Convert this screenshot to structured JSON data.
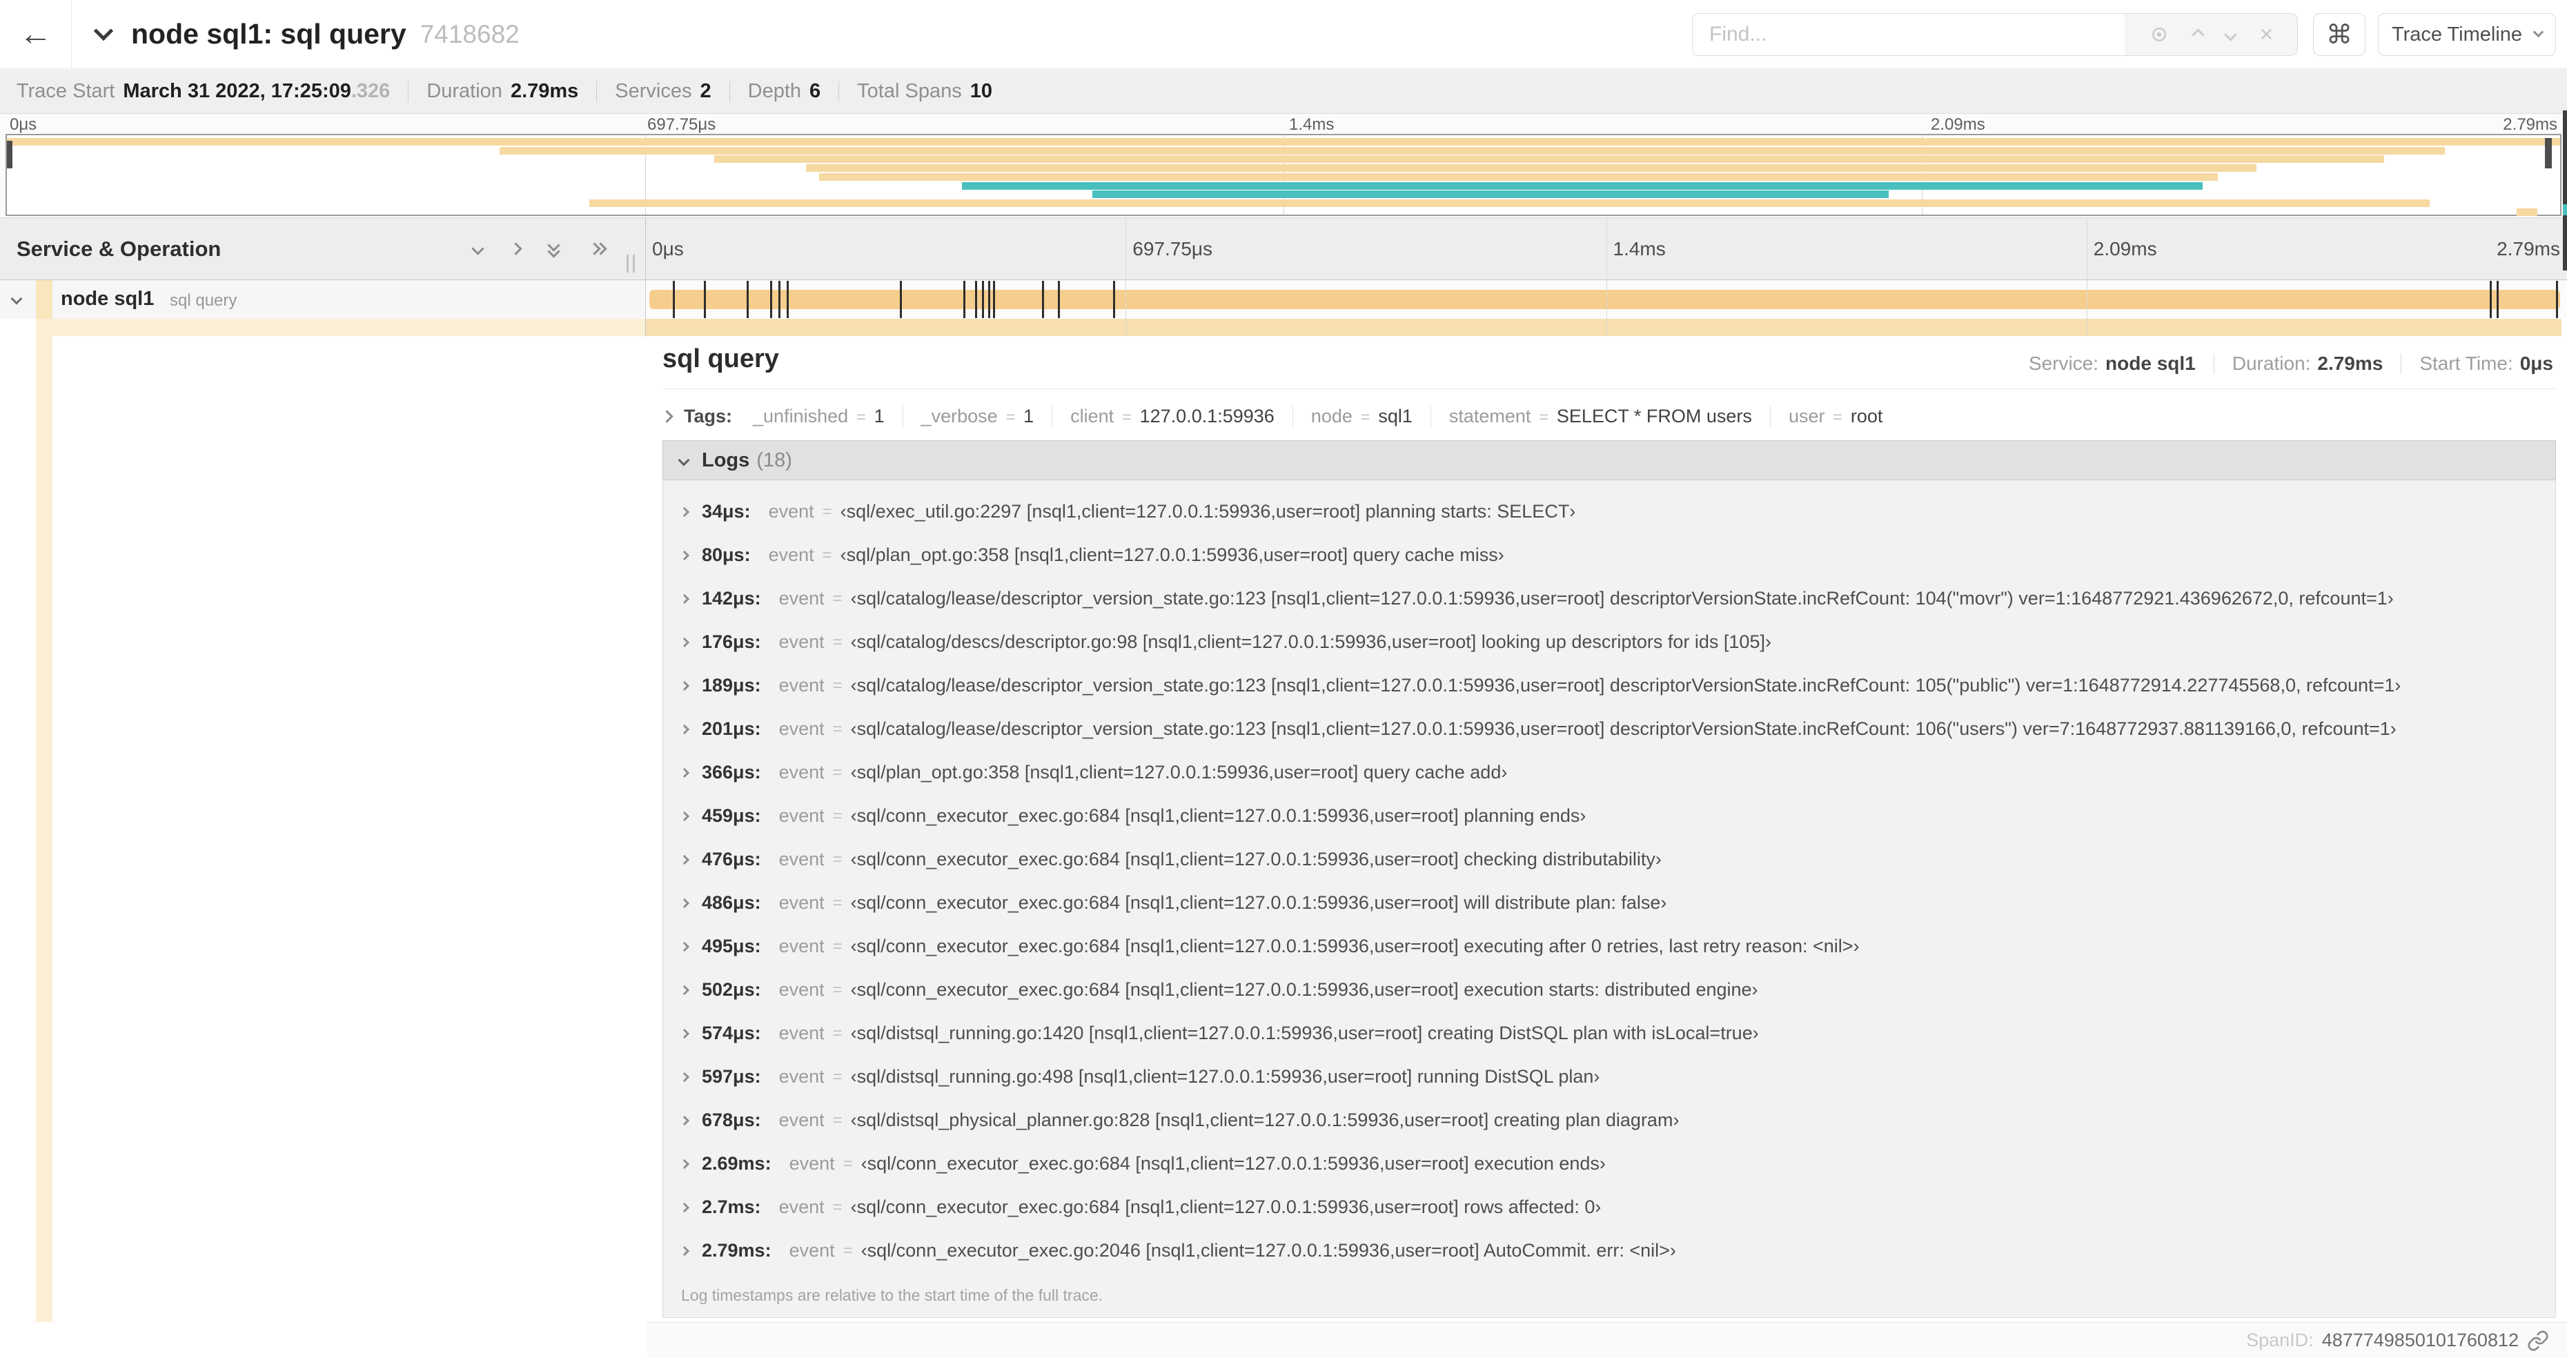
{
  "header": {
    "back_icon": "←",
    "title": "node sql1: sql query",
    "trace_id": "7418682",
    "find_placeholder": "Find...",
    "clear_icon": "×",
    "shortcut_icon": "⌘",
    "view_selector": "Trace Timeline"
  },
  "trace_stats": {
    "items": [
      {
        "label": "Trace Start",
        "value": "March 31 2022, 17:25:09",
        "extra": ".326"
      },
      {
        "label": "Duration",
        "value": "2.79ms",
        "extra": ""
      },
      {
        "label": "Services",
        "value": "2",
        "extra": ""
      },
      {
        "label": "Depth",
        "value": "6",
        "extra": ""
      },
      {
        "label": "Total Spans",
        "value": "10",
        "extra": ""
      }
    ]
  },
  "minimap": {
    "tick_labels": [
      {
        "label": "0μs",
        "pos": 0
      },
      {
        "label": "697.75μs",
        "pos": 0.25
      },
      {
        "label": "1.4ms",
        "pos": 0.5
      },
      {
        "label": "2.09ms",
        "pos": 0.75
      },
      {
        "label": "2.79ms",
        "pos": 1
      }
    ],
    "colors": {
      "tan": "#f6d8a1",
      "teal": "#49c0be"
    },
    "spans": [
      {
        "start": 0,
        "end": 1,
        "color": "tan"
      },
      {
        "start": 0.193,
        "end": 0.955,
        "color": "tan"
      },
      {
        "start": 0.277,
        "end": 0.931,
        "color": "tan"
      },
      {
        "start": 0.313,
        "end": 0.881,
        "color": "tan"
      },
      {
        "start": 0.318,
        "end": 0.866,
        "color": "tan"
      },
      {
        "start": 0.374,
        "end": 0.86,
        "color": "teal"
      },
      {
        "start": 0.425,
        "end": 0.737,
        "color": "teal"
      },
      {
        "start": 0.228,
        "end": 0.949,
        "color": "tan"
      },
      {
        "start": 0.983,
        "end": 0.991,
        "color": "tan"
      }
    ]
  },
  "timeline": {
    "column_header": "Service & Operation",
    "ruler_ticks": [
      {
        "label": "0μs",
        "pos": 0
      },
      {
        "label": "697.75μs",
        "pos": 0.25
      },
      {
        "label": "1.4ms",
        "pos": 0.5
      },
      {
        "label": "2.09ms",
        "pos": 0.75
      },
      {
        "label": "2.79ms",
        "pos": 1
      }
    ],
    "row": {
      "service": "node sql1",
      "operation": "sql query"
    },
    "bar_color": "#f5cd8c",
    "log_marker_positions": [
      0.0122,
      0.0287,
      0.0509,
      0.0631,
      0.0677,
      0.072,
      0.1312,
      0.1645,
      0.1706,
      0.1742,
      0.1774,
      0.18,
      0.2057,
      0.214,
      0.243,
      0.9642,
      0.9677,
      0.999
    ]
  },
  "detail": {
    "operation": "sql query",
    "meta": [
      {
        "label": "Service:",
        "value": "node sql1"
      },
      {
        "label": "Duration:",
        "value": "2.79ms"
      },
      {
        "label": "Start Time:",
        "value": "0μs"
      }
    ],
    "tags_label": "Tags:",
    "tags": [
      {
        "key": "_unfinished",
        "value": "1"
      },
      {
        "key": "_verbose",
        "value": "1"
      },
      {
        "key": "client",
        "value": "127.0.0.1:59936"
      },
      {
        "key": "node",
        "value": "sql1"
      },
      {
        "key": "statement",
        "value": "SELECT * FROM users"
      },
      {
        "key": "user",
        "value": "root"
      }
    ],
    "logs_label": "Logs",
    "logs_count": "(18)",
    "logs": [
      {
        "time": "34μs:",
        "key": "event",
        "value": "‹sql/exec_util.go:2297 [nsql1,client=127.0.0.1:59936,user=root] planning starts: SELECT›"
      },
      {
        "time": "80μs:",
        "key": "event",
        "value": "‹sql/plan_opt.go:358 [nsql1,client=127.0.0.1:59936,user=root] query cache miss›"
      },
      {
        "time": "142μs:",
        "key": "event",
        "value": "‹sql/catalog/lease/descriptor_version_state.go:123 [nsql1,client=127.0.0.1:59936,user=root] descriptorVersionState.incRefCount: 104(\"movr\") ver=1:1648772921.436962672,0, refcount=1›"
      },
      {
        "time": "176μs:",
        "key": "event",
        "value": "‹sql/catalog/descs/descriptor.go:98 [nsql1,client=127.0.0.1:59936,user=root] looking up descriptors for ids [105]›"
      },
      {
        "time": "189μs:",
        "key": "event",
        "value": "‹sql/catalog/lease/descriptor_version_state.go:123 [nsql1,client=127.0.0.1:59936,user=root] descriptorVersionState.incRefCount: 105(\"public\") ver=1:1648772914.227745568,0, refcount=1›"
      },
      {
        "time": "201μs:",
        "key": "event",
        "value": "‹sql/catalog/lease/descriptor_version_state.go:123 [nsql1,client=127.0.0.1:59936,user=root] descriptorVersionState.incRefCount: 106(\"users\") ver=7:1648772937.881139166,0, refcount=1›"
      },
      {
        "time": "366μs:",
        "key": "event",
        "value": "‹sql/plan_opt.go:358 [nsql1,client=127.0.0.1:59936,user=root] query cache add›"
      },
      {
        "time": "459μs:",
        "key": "event",
        "value": "‹sql/conn_executor_exec.go:684 [nsql1,client=127.0.0.1:59936,user=root] planning ends›"
      },
      {
        "time": "476μs:",
        "key": "event",
        "value": "‹sql/conn_executor_exec.go:684 [nsql1,client=127.0.0.1:59936,user=root] checking distributability›"
      },
      {
        "time": "486μs:",
        "key": "event",
        "value": "‹sql/conn_executor_exec.go:684 [nsql1,client=127.0.0.1:59936,user=root] will distribute plan: false›"
      },
      {
        "time": "495μs:",
        "key": "event",
        "value": "‹sql/conn_executor_exec.go:684 [nsql1,client=127.0.0.1:59936,user=root] executing after 0 retries, last retry reason: <nil>›"
      },
      {
        "time": "502μs:",
        "key": "event",
        "value": "‹sql/conn_executor_exec.go:684 [nsql1,client=127.0.0.1:59936,user=root] execution starts: distributed engine›"
      },
      {
        "time": "574μs:",
        "key": "event",
        "value": "‹sql/distsql_running.go:1420 [nsql1,client=127.0.0.1:59936,user=root] creating DistSQL plan with isLocal=true›"
      },
      {
        "time": "597μs:",
        "key": "event",
        "value": "‹sql/distsql_running.go:498 [nsql1,client=127.0.0.1:59936,user=root] running DistSQL plan›"
      },
      {
        "time": "678μs:",
        "key": "event",
        "value": "‹sql/distsql_physical_planner.go:828 [nsql1,client=127.0.0.1:59936,user=root] creating plan diagram›"
      },
      {
        "time": "2.69ms:",
        "key": "event",
        "value": "‹sql/conn_executor_exec.go:684 [nsql1,client=127.0.0.1:59936,user=root] execution ends›"
      },
      {
        "time": "2.7ms:",
        "key": "event",
        "value": "‹sql/conn_executor_exec.go:684 [nsql1,client=127.0.0.1:59936,user=root] rows affected: 0›"
      },
      {
        "time": "2.79ms:",
        "key": "event",
        "value": "‹sql/conn_executor_exec.go:2046 [nsql1,client=127.0.0.1:59936,user=root] AutoCommit. err: <nil>›"
      }
    ],
    "footer_note": "Log timestamps are relative to the start time of the full trace.",
    "span_id_label": "SpanID:",
    "span_id": "4877749850101760812"
  }
}
